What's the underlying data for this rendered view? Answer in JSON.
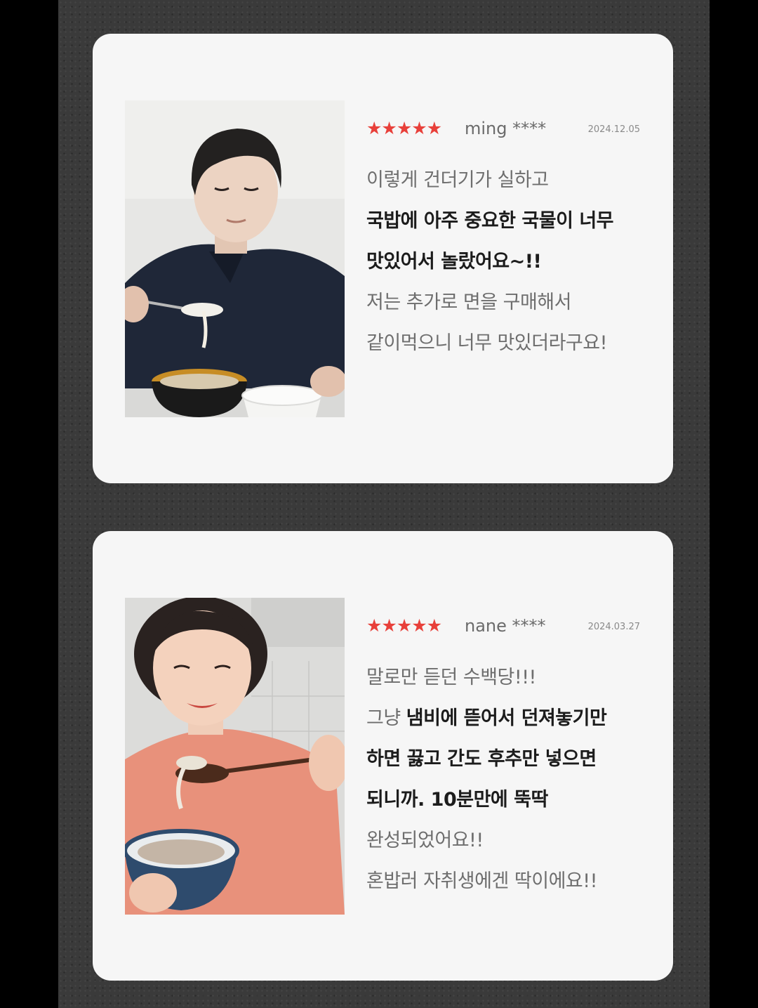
{
  "reviews": [
    {
      "stars": "★★★★★",
      "user": "ming ****",
      "date": "2024.12.05",
      "lines": [
        {
          "text": "이렇게 건더기가 실하고",
          "bold": false
        },
        {
          "text": "국밥에 아주 중요한 국물이 너무",
          "bold": true
        },
        {
          "text": "맛있어서 놀랐어요~!!",
          "bold": true
        },
        {
          "text": "저는 추가로 면을 구매해서",
          "bold": false
        },
        {
          "text": "같이먹으니 너무 맛있더라구요!",
          "bold": false
        }
      ]
    },
    {
      "stars": "★★★★★",
      "user": "nane ****",
      "date": "2024.03.27",
      "lines": [
        {
          "text": "말로만 듣던 수백당!!!",
          "bold": false
        },
        {
          "prefix": "그냥 ",
          "text": "냄비에 뜯어서 던져놓기만",
          "bold": true,
          "mixed": true
        },
        {
          "text": "하면 끓고 간도 후추만 넣으면",
          "bold": true
        },
        {
          "text": "되니까. 10분만에 뚝딱",
          "bold": true
        },
        {
          "text": "완성되었어요!!",
          "bold": false
        },
        {
          "text": "혼밥러 자취생에겐 딱이에요!!",
          "bold": false
        }
      ]
    }
  ],
  "colors": {
    "star": "#e8403a",
    "card": "#f6f6f6",
    "background": "#3a3a3a"
  }
}
